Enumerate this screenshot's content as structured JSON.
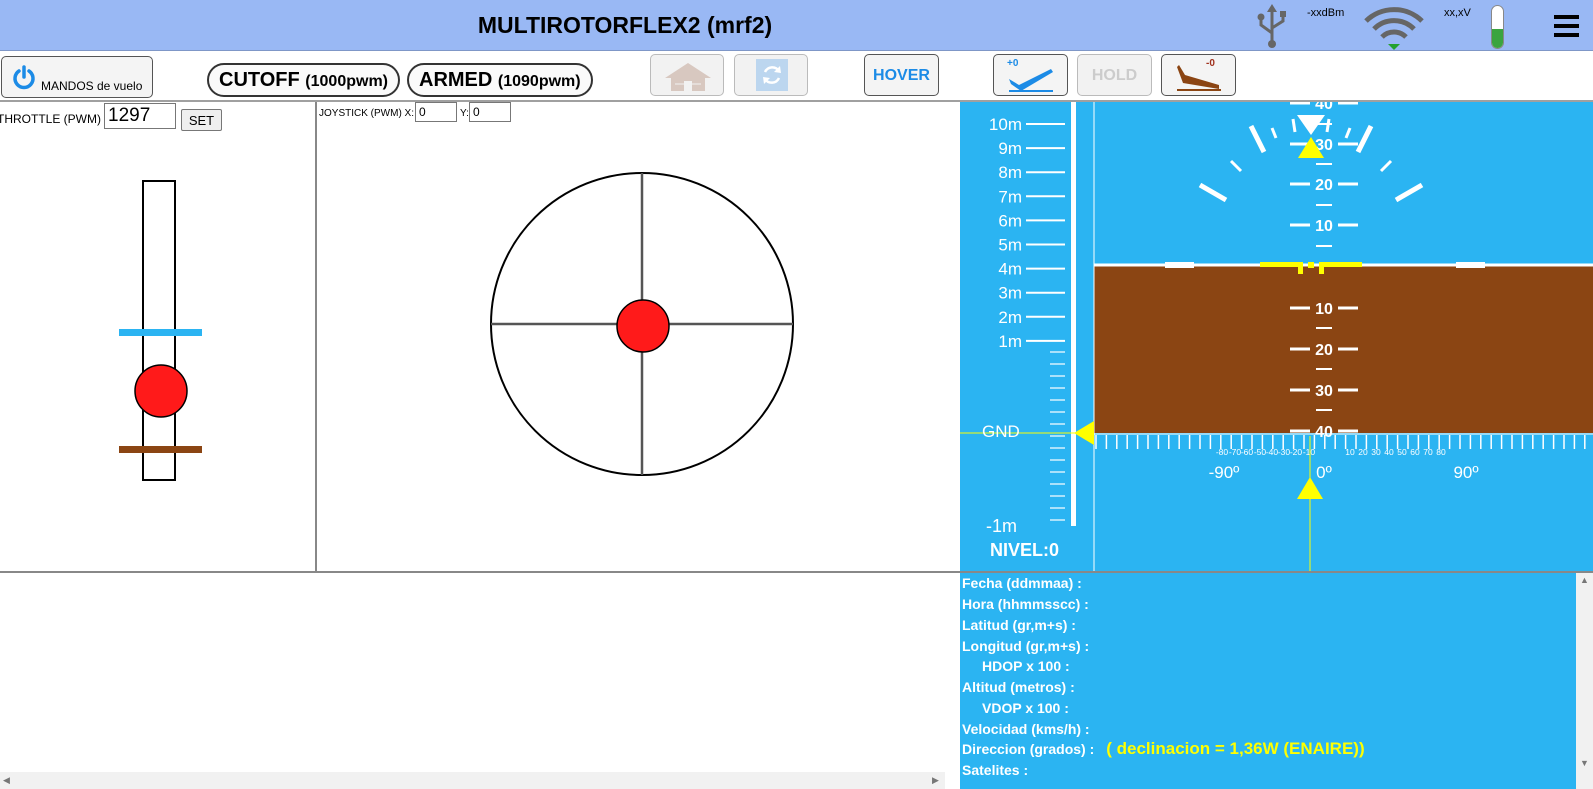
{
  "header": {
    "title": "MULTIROTORFLEX2 (mrf2)",
    "rssi": "-xxdBm",
    "voltage": "xx,xV",
    "battery_level": 0.46
  },
  "toolbar": {
    "mandos_label": "MANDOS de vuelo",
    "cutoff_label": "CUTOFF",
    "cutoff_value": "(1000pwm)",
    "armed_label": "ARMED",
    "armed_value": "(1090pwm)",
    "hover_label": "HOVER",
    "hold_label": "HOLD",
    "takeoff_badge": "+0",
    "land_badge": "-0"
  },
  "throttle": {
    "label": "THROTTLE (PWM)",
    "value": "1297",
    "set_label": "SET"
  },
  "joystick": {
    "label": "JOYSTICK (PWM) X:",
    "x_value": "0",
    "y_label": "Y:",
    "y_value": "0"
  },
  "hud": {
    "altitude_labels": [
      "10m",
      "9m",
      "8m",
      "7m",
      "6m",
      "5m",
      "4m",
      "3m",
      "2m",
      "1m"
    ],
    "gnd_label": "GND",
    "neg_label": "-1m",
    "nivel_label": "NIVEL:0",
    "pitch_up_labels": [
      "40",
      "30",
      "20",
      "10"
    ],
    "pitch_down_labels": [
      "10",
      "20",
      "30",
      "40"
    ],
    "heading_small_labels": [
      "-80",
      "-70",
      "-60",
      "-50",
      "-40",
      "-30",
      "-20",
      "-10",
      "10",
      "20",
      "30",
      "40",
      "50",
      "60",
      "70",
      "80"
    ],
    "heading_big_labels": [
      "-90º",
      "0º",
      "90º"
    ],
    "colors": {
      "sky": "#2bb4f2",
      "ground": "#8b4513",
      "marker": "#ffff00"
    }
  },
  "gps": {
    "fecha": "Fecha (ddmmaa) :",
    "hora": "Hora (hhmmsscc) :",
    "latitud": "Latitud (gr,m+s) :",
    "longitud": "Longitud (gr,m+s) :",
    "hdop": "HDOP x 100 :",
    "altitud": "Altitud (metros) :",
    "vdop": "VDOP x 100 :",
    "velocidad": "Velocidad (kms/h) :",
    "direccion": "Direccion (grados) :",
    "declinacion": "( declinacion = 1,36W (ENAIRE))",
    "satelites": "Satelites :"
  }
}
